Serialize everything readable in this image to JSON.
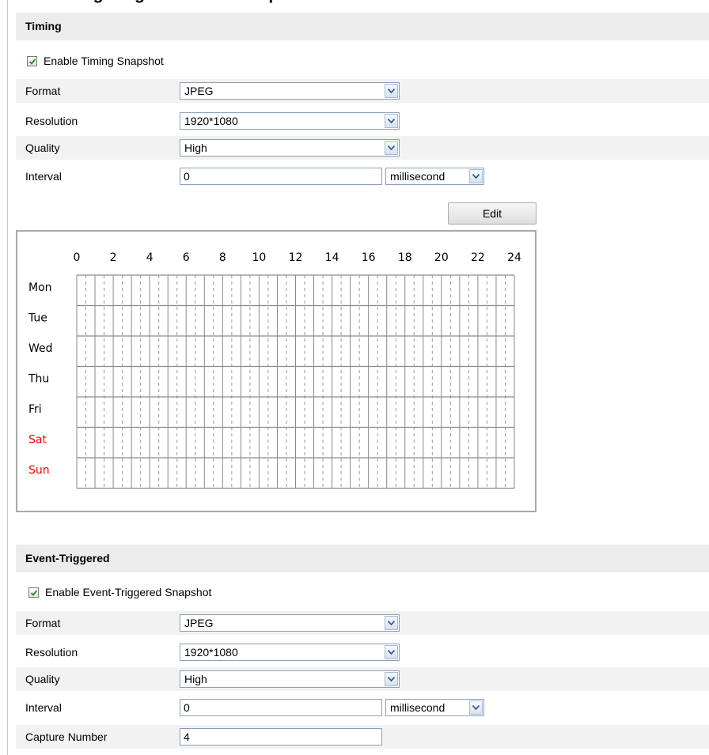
{
  "page_heading": "Configuring Scheduled Snapshot",
  "timing": {
    "section_title": "Timing",
    "enable_label": "Enable Timing Snapshot",
    "enable_checked": true,
    "format_label": "Format",
    "format_value": "JPEG",
    "resolution_label": "Resolution",
    "resolution_value": "1920*1080",
    "quality_label": "Quality",
    "quality_value": "High",
    "interval_label": "Interval",
    "interval_value": "0",
    "interval_unit": "millisecond",
    "edit_label": "Edit"
  },
  "schedule": {
    "hours": [
      "0",
      "2",
      "4",
      "6",
      "8",
      "10",
      "12",
      "14",
      "16",
      "18",
      "20",
      "22",
      "24"
    ],
    "days": [
      {
        "name": "Mon",
        "color": "#000000"
      },
      {
        "name": "Tue",
        "color": "#000000"
      },
      {
        "name": "Wed",
        "color": "#000000"
      },
      {
        "name": "Thu",
        "color": "#000000"
      },
      {
        "name": "Fri",
        "color": "#000000"
      },
      {
        "name": "Sat",
        "color": "#ff0000"
      },
      {
        "name": "Sun",
        "color": "#ff0000"
      }
    ]
  },
  "event": {
    "section_title": "Event-Triggered",
    "enable_label": "Enable Event-Triggered Snapshot",
    "enable_checked": true,
    "format_label": "Format",
    "format_value": "JPEG",
    "resolution_label": "Resolution",
    "resolution_value": "1920*1080",
    "quality_label": "Quality",
    "quality_value": "High",
    "interval_label": "Interval",
    "interval_value": "0",
    "interval_unit": "millisecond",
    "capture_label": "Capture Number",
    "capture_value": "4"
  },
  "colors": {
    "section_bg": "#ececec",
    "row_shade": "#f2f2f2",
    "weekend": "#ff0000",
    "check": "#2a8a2a"
  }
}
